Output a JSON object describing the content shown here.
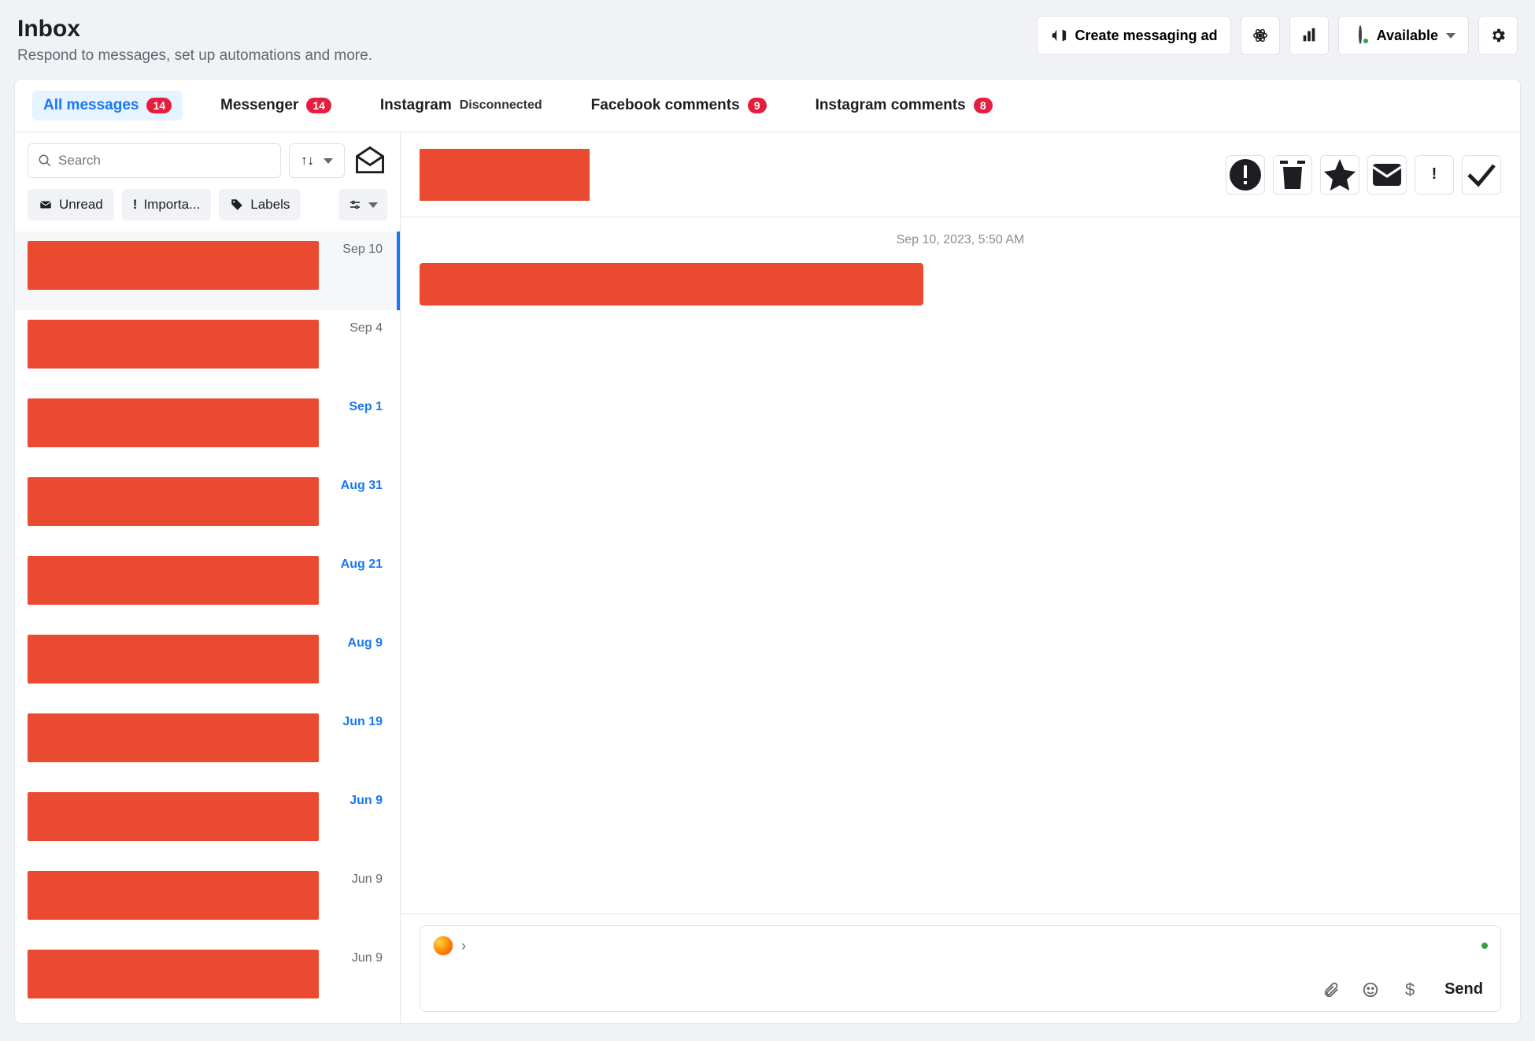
{
  "header": {
    "title": "Inbox",
    "subtitle": "Respond to messages, set up automations and more.",
    "create_ad": "Create messaging ad",
    "availability": "Available"
  },
  "tabs": [
    {
      "label": "All messages",
      "count": "14",
      "active": true
    },
    {
      "label": "Messenger",
      "count": "14"
    },
    {
      "label": "Instagram",
      "status": "Disconnected"
    },
    {
      "label": "Facebook comments",
      "count": "9"
    },
    {
      "label": "Instagram comments",
      "count": "8"
    }
  ],
  "filters": {
    "search_placeholder": "Search",
    "unread": "Unread",
    "important": "Importa...",
    "labels": "Labels"
  },
  "conversations": [
    {
      "date": "Sep 10",
      "unread": false,
      "selected": true
    },
    {
      "date": "Sep 4",
      "unread": false
    },
    {
      "date": "Sep 1",
      "unread": true
    },
    {
      "date": "Aug 31",
      "unread": true
    },
    {
      "date": "Aug 21",
      "unread": true
    },
    {
      "date": "Aug 9",
      "unread": true
    },
    {
      "date": "Jun 19",
      "unread": true
    },
    {
      "date": "Jun 9",
      "unread": true
    },
    {
      "date": "Jun 9",
      "unread": false
    },
    {
      "date": "Jun 9",
      "unread": false
    }
  ],
  "message_view": {
    "timestamp": "Sep 10, 2023, 5:50 AM"
  },
  "composer": {
    "send": "Send",
    "currency": "$"
  }
}
